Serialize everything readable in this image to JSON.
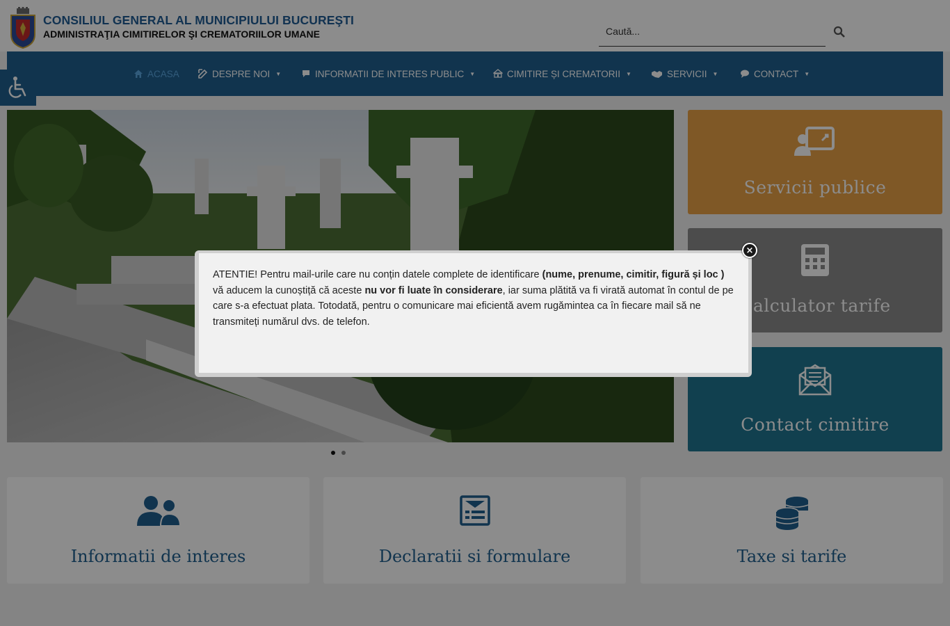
{
  "header": {
    "title_line1": "CONSILIUL GENERAL AL MUNICIPIULUI BUCUREŞTI",
    "title_line2": "ADMINISTRAŢIA CIMITIRELOR ŞI CREMATORIILOR UMANE",
    "search_placeholder": "Caută..."
  },
  "nav": {
    "items": [
      {
        "label": "ACASA",
        "icon": "home-icon",
        "active": true
      },
      {
        "label": "DESPRE NOI",
        "icon": "edit-icon"
      },
      {
        "label": "INFORMATII DE INTERES PUBLIC",
        "icon": "info-icon"
      },
      {
        "label": "CIMITIRE ȘI CREMATORII",
        "icon": "building-icon"
      },
      {
        "label": "SERVICII",
        "icon": "handshake-icon"
      },
      {
        "label": "CONTACT",
        "icon": "comment-icon"
      }
    ]
  },
  "tiles": [
    {
      "label": "Servicii publice",
      "icon": "presentation-icon",
      "color": "#e8a046"
    },
    {
      "label": "Calculator tarife",
      "icon": "calculator-icon",
      "color": "#8a8a8a"
    },
    {
      "label": "Contact cimitire",
      "icon": "envelope-icon",
      "color": "#1f7591"
    }
  ],
  "cards": [
    {
      "label": "Informatii de interes",
      "icon": "users-icon"
    },
    {
      "label": "Declaratii si formulare",
      "icon": "form-icon"
    },
    {
      "label": "Taxe si tarife",
      "icon": "coins-icon"
    }
  ],
  "slider": {
    "slide_count": 2,
    "active_slide": 1
  },
  "modal": {
    "t1": "ATENTIE! Pentru mail-urile care nu conțin datele complete de identificare ",
    "b1": "(nume, prenume, cimitir, figură și loc )",
    "t2": " vă aducem la cunoștiță că aceste ",
    "b2": "nu vor fi luate în considerare",
    "t3": ", iar suma plătită va fi virată automat în contul de pe care s-a efectuat plata.  Totodată, pentru o comunicare mai eficientă avem rugămintea ca în fiecare mail să ne transmiteți numărul dvs. de telefon.",
    "close": "×"
  },
  "colors": {
    "nav_bg": "#1f5f8f",
    "accent_blue": "#1f5c94",
    "card_text": "#1f5f8f"
  }
}
